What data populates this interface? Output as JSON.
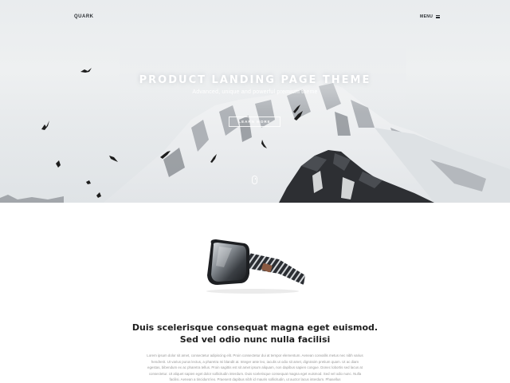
{
  "header": {
    "brand": "QUARK",
    "menu_label": "MENU"
  },
  "hero": {
    "title": "PRODUCT LANDING PAGE THEME",
    "subtitle": "Advanced, unique and powerful premium theme",
    "button_label": "LEARN MORE"
  },
  "feature": {
    "title_line1": "Duis scelerisque consequat magna eget euismod.",
    "title_line2": "Sed vel odio nunc nulla facilisi",
    "paragraph": "Lorem ipsum dolor sit amet, consectetur adipiscing elit. Proin consectetur dui at tempor elementum. Aenean convallis metus nec nibh varius hendrerit. Ut varius purus lectus, a pharetra mi blandit at. Integer ante leo, iaculis ut odio sit amet, dignissim pretium quam. Ut ac diam egestas, bibendum ex ac pharetra tellus. Proin sagittis est sit amet ipsum aliquam, non dapibus sapien congue. Donec lobortis sed lacus at consectetur. Ut aliquet sapien eget dolor sollicitudin interdum. Duis scelerisque consequat magna eget euismod. Sed vel odio nunc. Nulla facilisi. Aenean a tincidunt leo. Praesent dapibus nibh id mauris sollicitudin, ut auctor lacus interdum. Phasellus"
  },
  "colors": {
    "hero_sky": "#e9ecee",
    "text_dark": "#1e1e1e",
    "text_muted": "#9a9a9a",
    "rock_dark": "#2d2f33"
  }
}
